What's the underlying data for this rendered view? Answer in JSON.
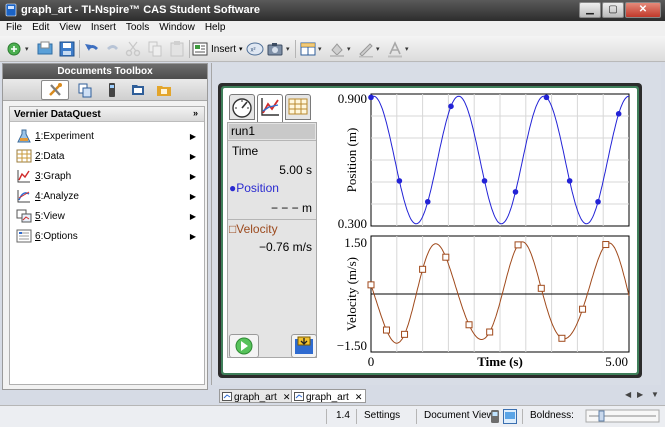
{
  "window": {
    "title": "graph_art - TI-Nspire™ CAS Student Software",
    "controls": [
      "minimize",
      "maximize",
      "close"
    ]
  },
  "menu": [
    "File",
    "Edit",
    "View",
    "Insert",
    "Tools",
    "Window",
    "Help"
  ],
  "toolbar": {
    "insert_label": "Insert"
  },
  "toolbox": {
    "title": "Documents Toolbox",
    "panel_title": "Vernier DataQuest",
    "items": [
      {
        "num": "1",
        "label": ":Experiment"
      },
      {
        "num": "2",
        "label": ":Data"
      },
      {
        "num": "3",
        "label": ":Graph"
      },
      {
        "num": "4",
        "label": ":Analyze"
      },
      {
        "num": "5",
        "label": ":View"
      },
      {
        "num": "6",
        "label": ":Options"
      }
    ]
  },
  "meter": {
    "run": "run1",
    "time_label": "Time",
    "time_value": "5.00 s",
    "position_label": "Position",
    "position_value": "− − − m",
    "velocity_label": "Velocity",
    "velocity_value": "−0.76 m/s"
  },
  "graph": {
    "x_label": "Time (s)",
    "x_min_label": "0",
    "x_max_label": "5.00",
    "position": {
      "y_label": "Position (m)",
      "y_max_label": "0.900",
      "y_min_label": "0.300",
      "color": "#2323d6"
    },
    "velocity": {
      "y_label": "Velocity (m/s)",
      "y_max_label": "1.50",
      "y_min_label": "−1.50",
      "color": "#a04a1c"
    }
  },
  "page_tabs": [
    {
      "label": "graph_art",
      "selected": false
    },
    {
      "label": "graph_art",
      "selected": true
    }
  ],
  "status": {
    "page": "1.4",
    "settings": "Settings",
    "doc_view": "Document View:",
    "boldness": "Boldness:"
  }
}
